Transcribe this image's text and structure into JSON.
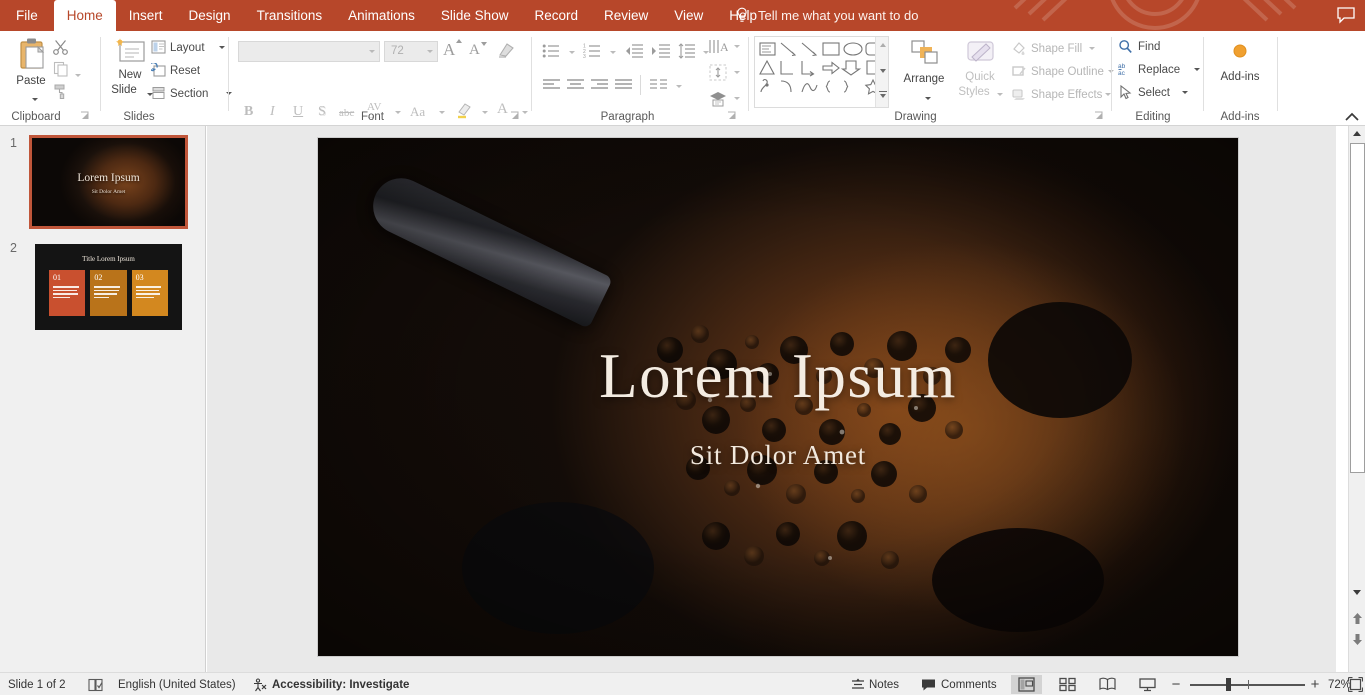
{
  "app": {
    "accent_color": "#b7472a",
    "tell_me_placeholder": "Tell me what you want to do",
    "comment_icon": "comment-icon",
    "bulb_icon": "lightbulb-icon"
  },
  "tabs": [
    {
      "id": "file",
      "label": "File",
      "active": false
    },
    {
      "id": "home",
      "label": "Home",
      "active": true
    },
    {
      "id": "insert",
      "label": "Insert",
      "active": false
    },
    {
      "id": "design",
      "label": "Design",
      "active": false
    },
    {
      "id": "transitions",
      "label": "Transitions",
      "active": false
    },
    {
      "id": "animations",
      "label": "Animations",
      "active": false
    },
    {
      "id": "slideshow",
      "label": "Slide Show",
      "active": false
    },
    {
      "id": "record",
      "label": "Record",
      "active": false
    },
    {
      "id": "review",
      "label": "Review",
      "active": false
    },
    {
      "id": "view",
      "label": "View",
      "active": false
    },
    {
      "id": "help",
      "label": "Help",
      "active": false
    }
  ],
  "ribbon": {
    "groups": [
      {
        "id": "clipboard",
        "label": "Clipboard"
      },
      {
        "id": "slides",
        "label": "Slides"
      },
      {
        "id": "font",
        "label": "Font"
      },
      {
        "id": "paragraph",
        "label": "Paragraph"
      },
      {
        "id": "drawing",
        "label": "Drawing"
      },
      {
        "id": "editing",
        "label": "Editing"
      },
      {
        "id": "addins",
        "label": "Add-ins"
      }
    ],
    "clipboard": {
      "paste_label": "Paste",
      "cut_icon": "scissors-icon",
      "copy_icon": "copy-icon",
      "format_painter_icon": "format-painter-icon"
    },
    "slides": {
      "new_slide_line1": "New",
      "new_slide_line2": "Slide",
      "layout_label": "Layout",
      "reset_label": "Reset",
      "section_label": "Section"
    },
    "font": {
      "font_name_value": "",
      "font_size_value": "72",
      "grow_font_icon": "grow-font-icon",
      "shrink_font_icon": "shrink-font-icon",
      "clear_formatting_icon": "clear-formatting-icon",
      "bold_label": "B",
      "italic_label": "I",
      "underline_label": "U",
      "shadow_label": "S",
      "strikethrough_label": "abc",
      "character_spacing_label": "AV",
      "change_case_label": "Aa",
      "text_highlight_icon": "text-highlight-icon",
      "font_color_label": "A"
    },
    "paragraph": {
      "bullets_icon": "bullets-icon",
      "numbering_icon": "numbering-icon",
      "decrease_indent_icon": "decrease-indent-icon",
      "increase_indent_icon": "increase-indent-icon",
      "line_spacing_icon": "line-spacing-icon",
      "text_direction_icon": "text-direction-icon",
      "align_text_icon": "align-text-icon",
      "smartart_icon": "convert-to-smartart-icon",
      "align_left_icon": "align-left-icon",
      "align_center_icon": "align-center-icon",
      "align_right_icon": "align-right-icon",
      "justify_icon": "justify-icon",
      "columns_icon": "columns-icon"
    },
    "drawing": {
      "arrange_label": "Arrange",
      "quick_styles_line1": "Quick",
      "quick_styles_line2": "Styles",
      "shape_fill_label": "Shape Fill",
      "shape_outline_label": "Shape Outline",
      "shape_effects_label": "Shape Effects"
    },
    "editing": {
      "find_label": "Find",
      "replace_label": "Replace",
      "select_label": "Select"
    },
    "addins": {
      "label": "Add-ins"
    }
  },
  "slide_panel": {
    "slides": [
      {
        "number": "1",
        "selected": true,
        "title": "Lorem Ipsum",
        "subtitle": "Sit Dolor Amet"
      },
      {
        "number": "2",
        "selected": false,
        "title": "Title Lorem Ipsum",
        "cards": [
          {
            "number": "01",
            "color": "#c9502f"
          },
          {
            "number": "02",
            "color": "#b9731a"
          },
          {
            "number": "03",
            "color": "#d3881f"
          }
        ]
      }
    ]
  },
  "slide": {
    "title": "Lorem Ipsum",
    "subtitle": "Sit Dolor Amet",
    "background_description": "coffee-cup-photo"
  },
  "status_bar": {
    "slide_counter": "Slide 1 of 2",
    "accessibility_checker_icon": "accessibility-checker-icon",
    "language": "English (United States)",
    "accessibility_icon": "accessibility-icon",
    "accessibility_label": "Accessibility: Investigate",
    "notes_label": "Notes",
    "notes_icon": "notes-icon",
    "comments_label": "Comments",
    "comments_icon": "comments-icon",
    "views": [
      {
        "id": "normal",
        "icon": "normal-view-icon",
        "active": true
      },
      {
        "id": "slide-sorter",
        "icon": "slide-sorter-icon",
        "active": false
      },
      {
        "id": "reading",
        "icon": "reading-view-icon",
        "active": false
      },
      {
        "id": "slideshow",
        "icon": "slide-show-icon",
        "active": false
      }
    ],
    "zoom_out_label": "−",
    "zoom_in_label": "+",
    "zoom_value": "72%",
    "fit_slide_icon": "fit-slide-to-window-icon"
  }
}
